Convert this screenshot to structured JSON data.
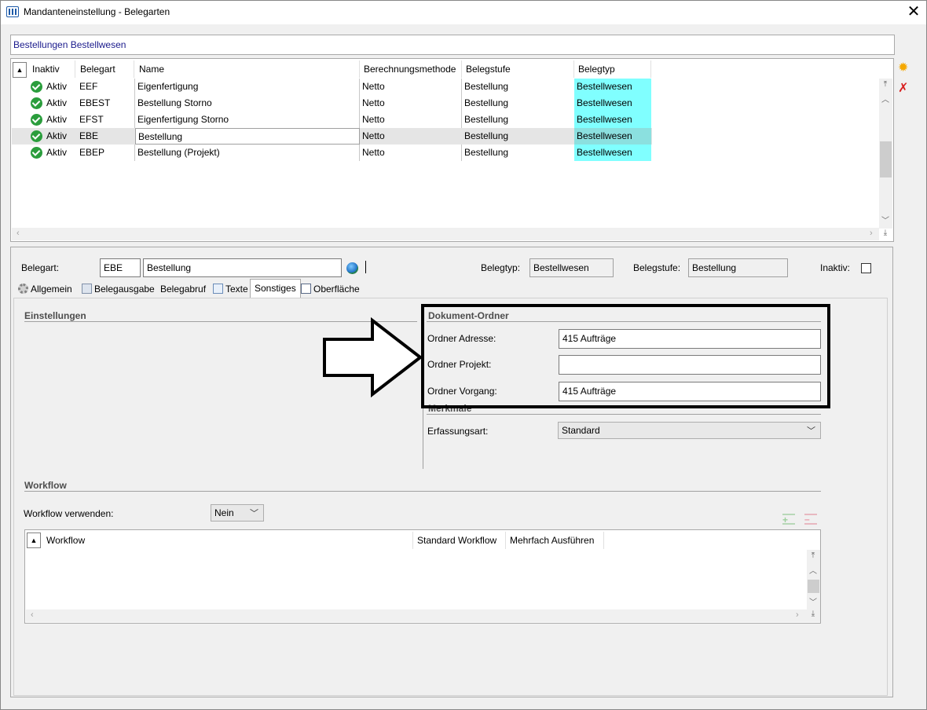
{
  "window": {
    "title": "Mandanteneinstellung - Belegarten",
    "close_glyph": "✕"
  },
  "filter": {
    "value": "Bestellungen Bestellwesen"
  },
  "belegarten_grid": {
    "columns": [
      "Inaktiv",
      "Belegart",
      "Name",
      "Berechnungsmethode",
      "Belegstufe",
      "Belegtyp"
    ],
    "rows": [
      {
        "inaktiv": "Aktiv",
        "belegart": "EEF",
        "name": "Eigenfertigung",
        "methode": "Netto",
        "stufe": "Bestellung",
        "typ": "Bestellwesen"
      },
      {
        "inaktiv": "Aktiv",
        "belegart": "EBEST",
        "name": "Bestellung Storno",
        "methode": "Netto",
        "stufe": "Bestellung",
        "typ": "Bestellwesen"
      },
      {
        "inaktiv": "Aktiv",
        "belegart": "EFST",
        "name": "Eigenfertigung  Storno",
        "methode": "Netto",
        "stufe": "Bestellung",
        "typ": "Bestellwesen"
      },
      {
        "inaktiv": "Aktiv",
        "belegart": "EBE",
        "name": "Bestellung",
        "methode": "Netto",
        "stufe": "Bestellung",
        "typ": "Bestellwesen",
        "selected": true
      },
      {
        "inaktiv": "Aktiv",
        "belegart": "EBEP",
        "name": "Bestellung (Projekt)",
        "methode": "Netto",
        "stufe": "Bestellung",
        "typ": "Bestellwesen"
      }
    ],
    "highlight_color": "#80ffff"
  },
  "side_toolbar": {
    "new_icon": "sun-new-icon",
    "delete_icon": "red-x-delete-icon"
  },
  "detail": {
    "belegart_label": "Belegart:",
    "belegart_code": "EBE",
    "belegart_name": "Bestellung",
    "belegtyp_label": "Belegtyp:",
    "belegtyp_value": "Bestellwesen",
    "belegstufe_label": "Belegstufe:",
    "belegstufe_value": "Bestellung",
    "inaktiv_label": "Inaktiv:",
    "inaktiv_checked": false
  },
  "tabs": [
    {
      "label": "Allgemein",
      "icon": "gear-icon"
    },
    {
      "label": "Belegausgabe",
      "icon": "printer-icon"
    },
    {
      "label": "Belegabruf",
      "icon": ""
    },
    {
      "label": "Texte",
      "icon": "notepad-icon"
    },
    {
      "label": "Sonstiges",
      "icon": "",
      "active": true
    },
    {
      "label": "Oberfläche",
      "icon": "form-icon"
    }
  ],
  "sonstiges": {
    "einstellungen_header": "Einstellungen",
    "dokument_ordner_header": "Dokument-Ordner",
    "ordner_adresse_label": "Ordner Adresse:",
    "ordner_adresse_value": "415 Aufträge",
    "ordner_projekt_label": "Ordner Projekt:",
    "ordner_projekt_value": "",
    "ordner_vorgang_label": "Ordner Vorgang:",
    "ordner_vorgang_value": "415 Aufträge",
    "merkmale_header": "Merkmale",
    "erfassungsart_label": "Erfassungsart:",
    "erfassungsart_value": "Standard",
    "workflow_header": "Workflow",
    "workflow_verwenden_label": "Workflow verwenden:",
    "workflow_verwenden_value": "Nein",
    "workflow_columns": [
      "Workflow",
      "Standard Workflow",
      "Mehrfach Ausführen"
    ]
  }
}
